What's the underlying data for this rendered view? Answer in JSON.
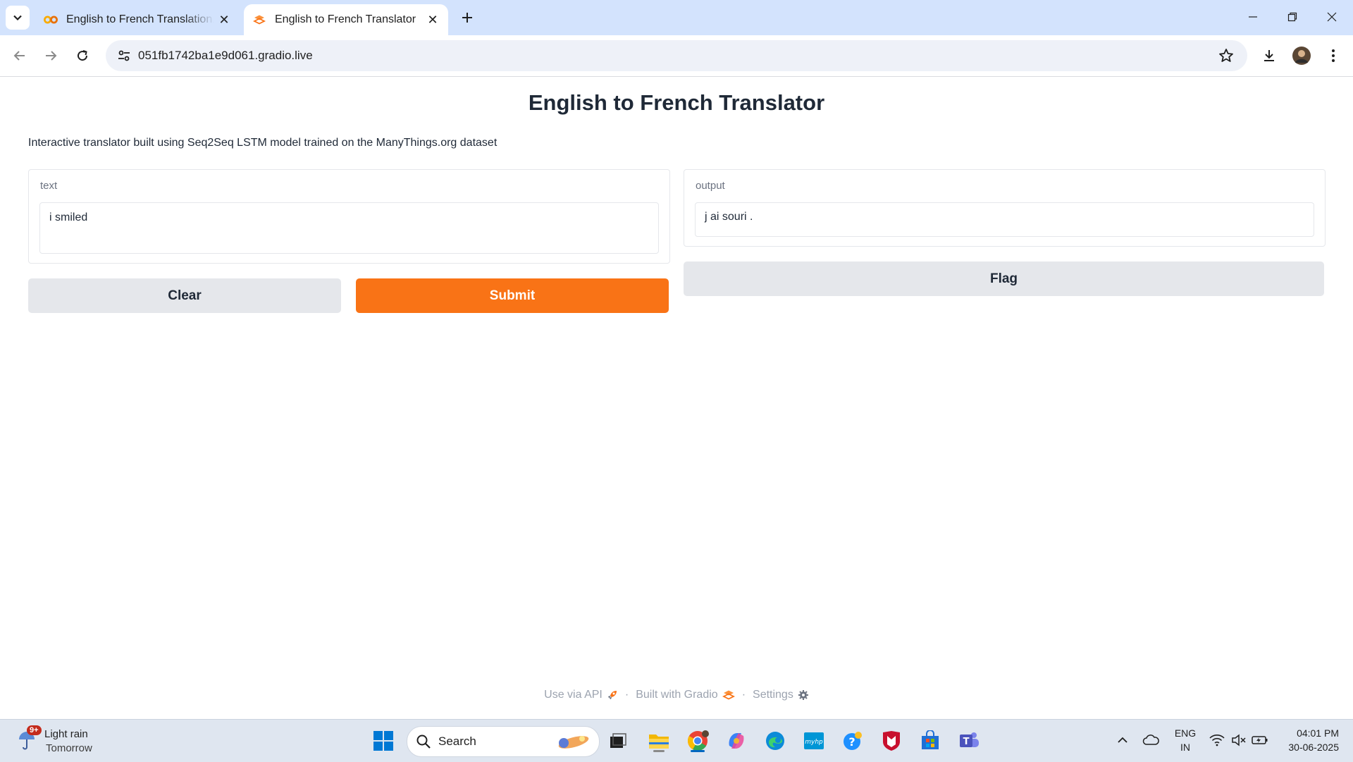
{
  "browser": {
    "tabs": [
      {
        "title": "English to French Translation.ipynb",
        "favicon": "colab-icon",
        "active": false
      },
      {
        "title": "English to French Translator",
        "favicon": "gradio-icon",
        "active": true
      }
    ],
    "url": "051fb1742ba1e9d061.gradio.live"
  },
  "app": {
    "title": "English to French Translator",
    "description": "Interactive translator built using Seq2Seq LSTM model trained on the ManyThings.org dataset",
    "input": {
      "label": "text",
      "value": "i smiled"
    },
    "output": {
      "label": "output",
      "value": "j ai souri ."
    },
    "buttons": {
      "clear": "Clear",
      "submit": "Submit",
      "flag": "Flag"
    },
    "footer": {
      "api": "Use via API",
      "built": "Built with Gradio",
      "settings": "Settings",
      "separator": "·"
    },
    "colors": {
      "primary": "#f97316",
      "secondary": "#e5e7eb"
    }
  },
  "taskbar": {
    "weather": {
      "condition": "Light rain",
      "when": "Tomorrow",
      "badge": "9+"
    },
    "search_placeholder": "Search",
    "lang": {
      "line1": "ENG",
      "line2": "IN"
    },
    "clock": {
      "time": "04:01 PM",
      "date": "30-06-2025"
    }
  }
}
